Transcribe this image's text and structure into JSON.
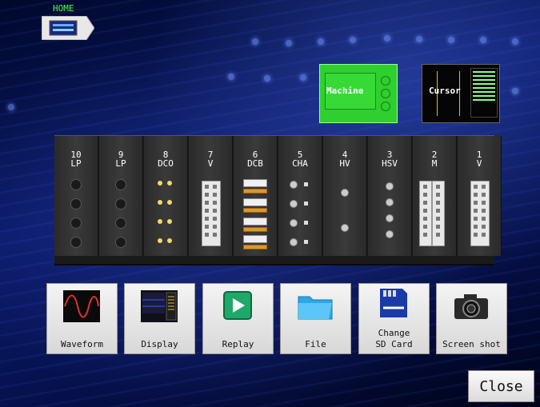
{
  "home": {
    "label": "HOME"
  },
  "thumbnails": {
    "machine": {
      "label": "Machine"
    },
    "cursor": {
      "label": "Cursor"
    }
  },
  "rack": {
    "slots": [
      {
        "number": "10",
        "type": "LP"
      },
      {
        "number": "9",
        "type": "LP"
      },
      {
        "number": "8",
        "type": "DCO"
      },
      {
        "number": "7",
        "type": "V"
      },
      {
        "number": "6",
        "type": "DCB"
      },
      {
        "number": "5",
        "type": "CHA"
      },
      {
        "number": "4",
        "type": "HV"
      },
      {
        "number": "3",
        "type": "HSV"
      },
      {
        "number": "2",
        "type": "M"
      },
      {
        "number": "1",
        "type": "V"
      }
    ]
  },
  "buttons": {
    "waveform": "Waveform",
    "display": "Display",
    "replay": "Replay",
    "file": "File",
    "sdcard_line1": "Change",
    "sdcard_line2": "SD Card",
    "screenshot": "Screen shot"
  },
  "close": {
    "label": "Close"
  },
  "colors": {
    "home_label": "#4cff4c",
    "machine_bg": "#2ecf2e",
    "background": "#0a1a6a"
  }
}
